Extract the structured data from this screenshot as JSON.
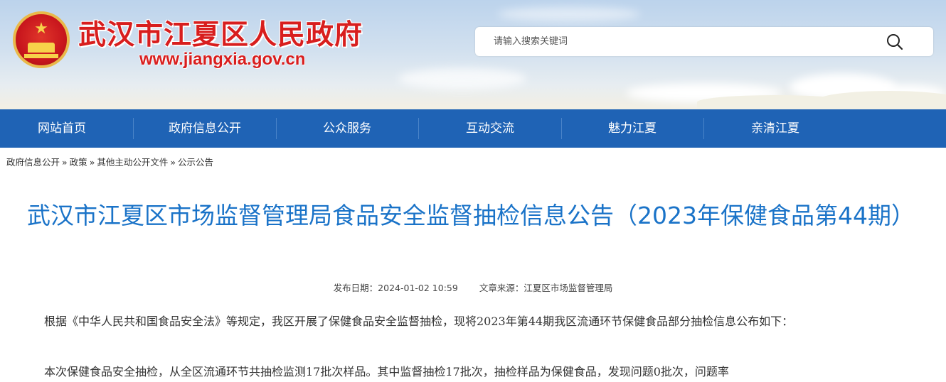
{
  "header": {
    "site_title": "武汉市江夏区人民政府",
    "site_url": "www.jiangxia.gov.cn",
    "emblem_icon": "national-emblem-icon",
    "search": {
      "placeholder": "请输入搜索关键词",
      "icon": "search-icon"
    }
  },
  "nav": {
    "items": [
      {
        "label": "网站首页"
      },
      {
        "label": "政府信息公开"
      },
      {
        "label": "公众服务"
      },
      {
        "label": "互动交流"
      },
      {
        "label": "魅力江夏"
      },
      {
        "label": "亲清江夏"
      }
    ]
  },
  "breadcrumb": {
    "items": [
      {
        "label": "政府信息公开"
      },
      {
        "label": "政策"
      },
      {
        "label": "其他主动公开文件"
      },
      {
        "label": "公示公告"
      }
    ],
    "separator": "»"
  },
  "article": {
    "title": "武汉市江夏区市场监督管理局食品安全监督抽检信息公告（2023年保健食品第44期）",
    "publish_date_label": "发布日期：",
    "publish_date": "2024-01-02 10:59",
    "source_label": "文章来源：",
    "source": "江夏区市场监督管理局",
    "paragraphs": [
      "根据《中华人民共和国食品安全法》等规定，我区开展了保健食品安全监督抽检，现将2023年第44期我区流通环节保健食品部分抽检信息公布如下：",
      "本次保健食品安全抽检，从全区流通环节共抽检监测17批次样品。其中监督抽检17批次，抽检样品为保健食品，发现问题0批次，问题率"
    ]
  },
  "colors": {
    "nav_background": "#1f63b5",
    "title_blue": "#1a73c8",
    "site_red": "#d81e1e"
  }
}
